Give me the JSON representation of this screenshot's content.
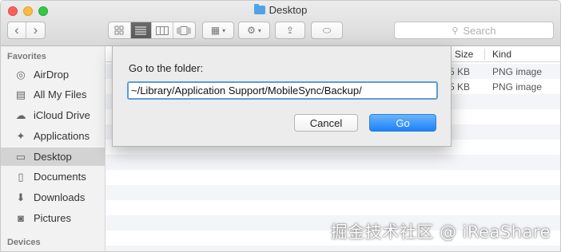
{
  "window": {
    "title": "Desktop",
    "title_icon": "folder-icon"
  },
  "toolbar": {
    "back_glyph": "‹",
    "forward_glyph": "›",
    "view_modes": [
      "icon-view-icon",
      "list-view-icon",
      "column-view-icon",
      "cover-flow-icon"
    ],
    "active_view": "list-view-icon",
    "arrange_glyph": "▦",
    "action_glyph": "⚙",
    "share_glyph": "⇪",
    "tag_glyph": "⬭",
    "search_placeholder": "Search"
  },
  "sidebar": {
    "favorites_heading": "Favorites",
    "devices_heading": "Devices",
    "items": [
      {
        "label": "AirDrop",
        "icon": "airdrop-icon",
        "glyph": "◎"
      },
      {
        "label": "All My Files",
        "icon": "all-files-icon",
        "glyph": "▤"
      },
      {
        "label": "iCloud Drive",
        "icon": "cloud-icon",
        "glyph": "☁"
      },
      {
        "label": "Applications",
        "icon": "applications-icon",
        "glyph": "✦"
      },
      {
        "label": "Desktop",
        "icon": "desktop-icon",
        "glyph": "▭",
        "selected": true
      },
      {
        "label": "Documents",
        "icon": "documents-icon",
        "glyph": "▯"
      },
      {
        "label": "Downloads",
        "icon": "downloads-icon",
        "glyph": "⬇"
      },
      {
        "label": "Pictures",
        "icon": "pictures-icon",
        "glyph": "◙"
      }
    ]
  },
  "file_list": {
    "columns": {
      "size": "Size",
      "kind": "Kind"
    },
    "rows": [
      {
        "size": "5 KB",
        "kind": "PNG image"
      },
      {
        "size": "5 KB",
        "kind": "PNG image"
      }
    ]
  },
  "dialog": {
    "label": "Go to the folder:",
    "path_value": "~/Library/Application Support/MobileSync/Backup/",
    "cancel_label": "Cancel",
    "go_label": "Go"
  },
  "watermark": "掘金技术社区 @ iReaShare"
}
